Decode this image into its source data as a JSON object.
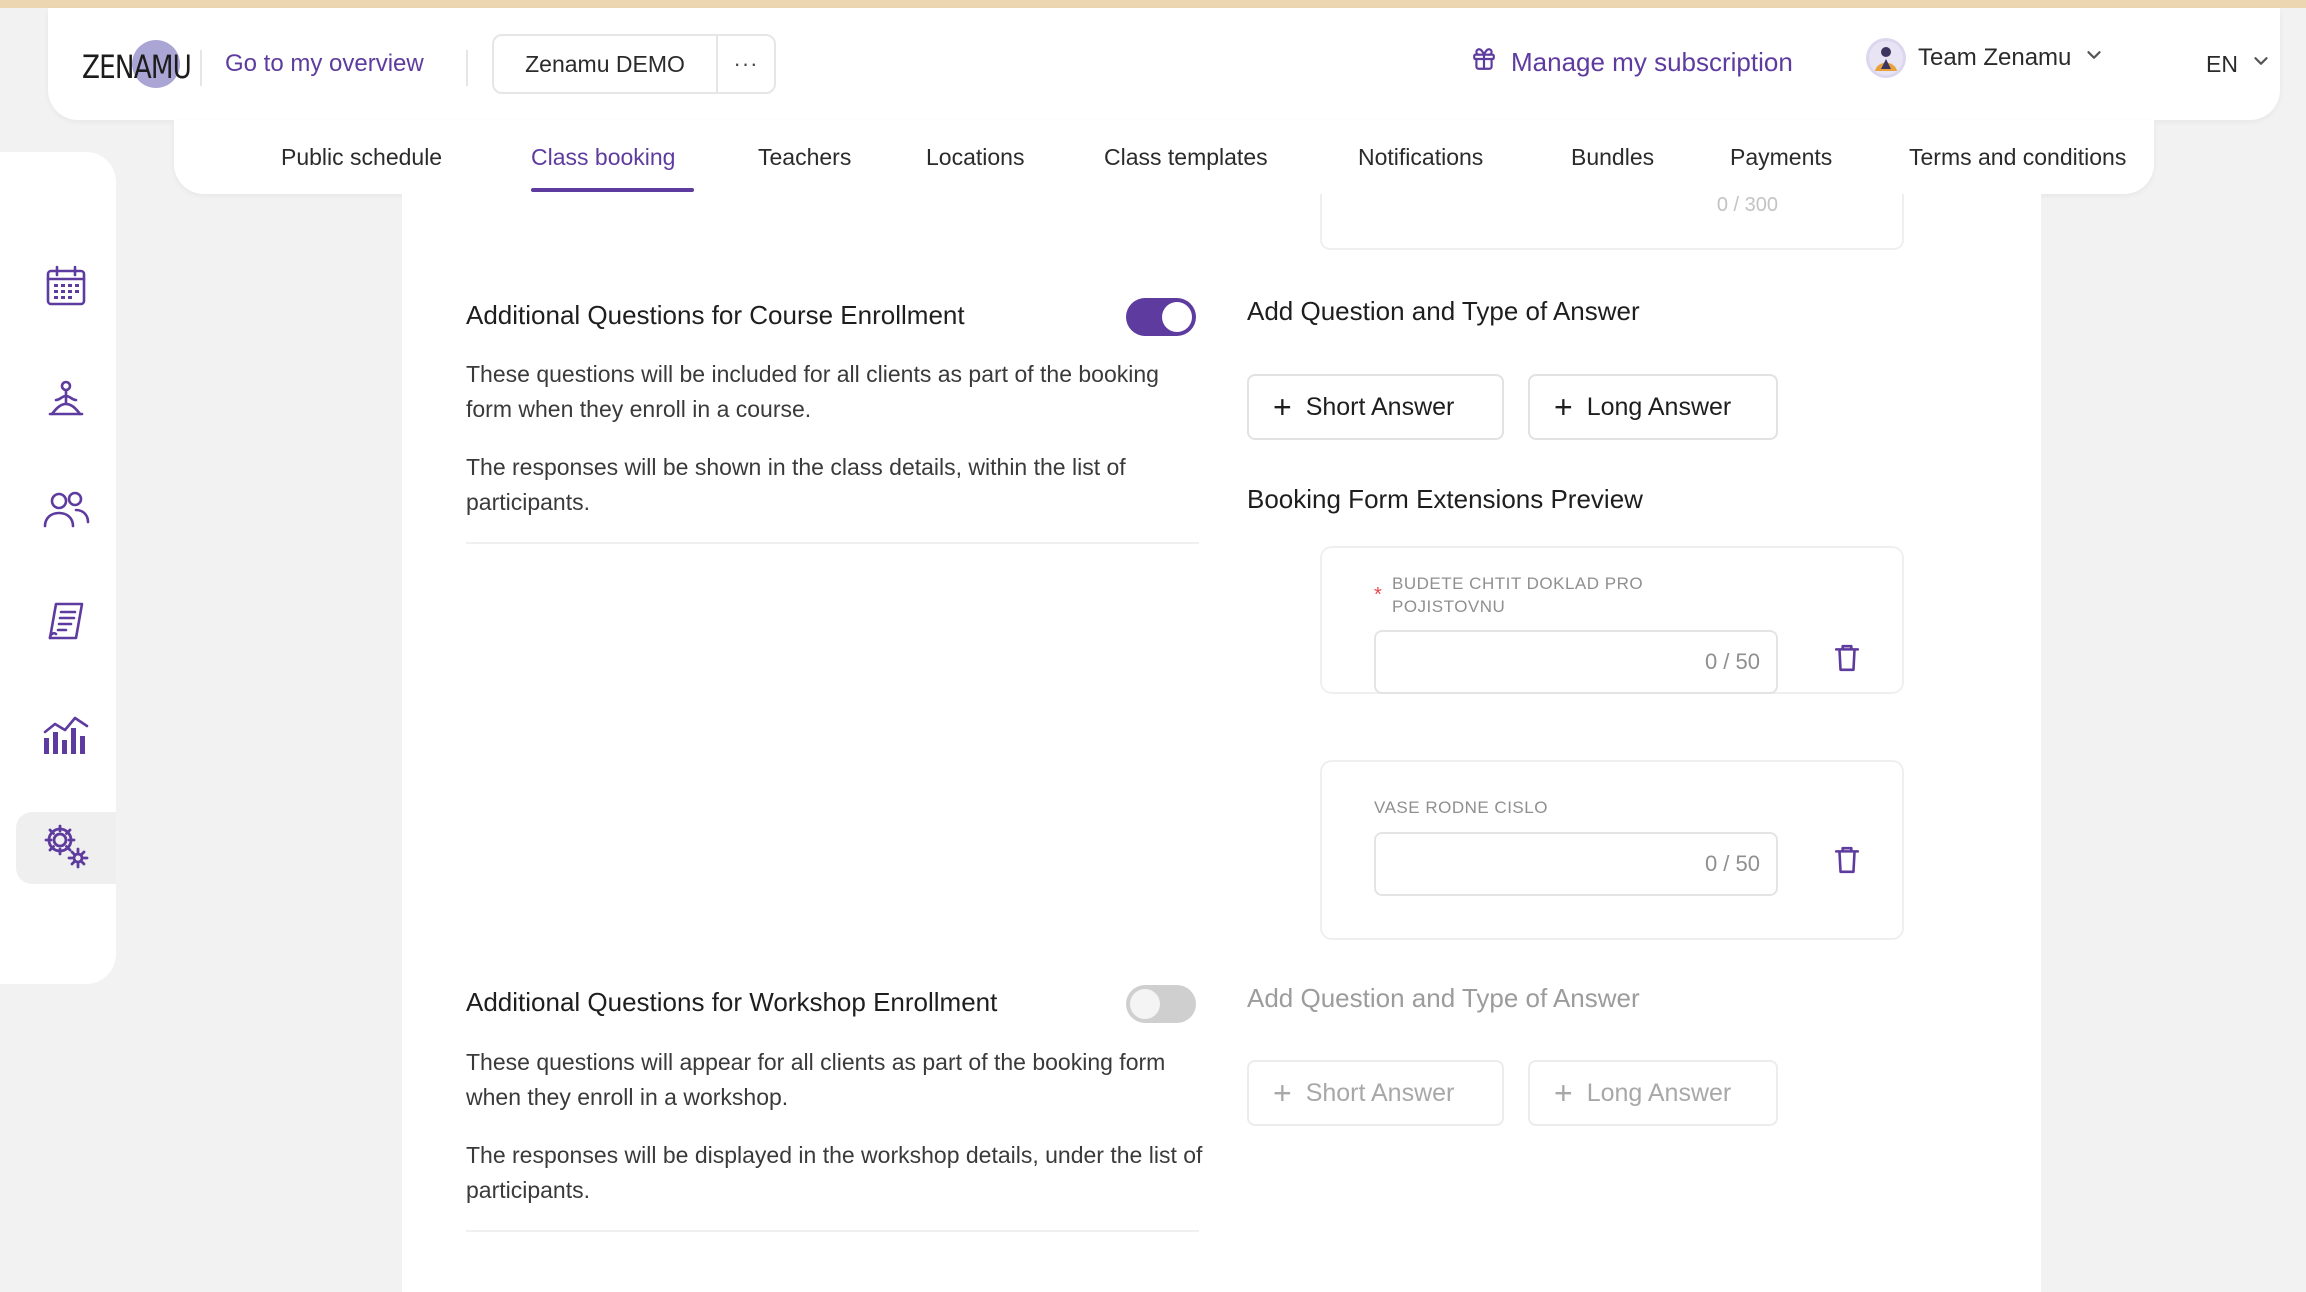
{
  "header": {
    "logo_text": "ZENAMU",
    "overview_link": "Go to my overview",
    "studio_name": "Zenamu DEMO",
    "studio_more": "···",
    "subscription_link": "Manage my subscription",
    "team_name": "Team Zenamu",
    "language": "EN"
  },
  "tabs": [
    {
      "label": "Public schedule"
    },
    {
      "label": "Class booking"
    },
    {
      "label": "Teachers"
    },
    {
      "label": "Locations"
    },
    {
      "label": "Class templates"
    },
    {
      "label": "Notifications"
    },
    {
      "label": "Bundles"
    },
    {
      "label": "Payments"
    },
    {
      "label": "Terms and conditions"
    }
  ],
  "sidebar": {
    "items": [
      "calendar-icon",
      "yoga-icon",
      "people-icon",
      "receipt-icon",
      "chart-icon",
      "settings-icon"
    ],
    "active": "settings-icon"
  },
  "previous_field": {
    "counter": "0 / 300"
  },
  "course": {
    "title": "Additional Questions for Course Enrollment",
    "enabled": true,
    "desc1": "These questions will be included for all clients as part of the booking form when they enroll in a course.",
    "desc2": "The responses will be shown in the class details, within the list of participants.",
    "add_title": "Add Question and Type of Answer",
    "short_answer": "Short Answer",
    "long_answer": "Long Answer",
    "preview_title": "Booking Form Extensions Preview",
    "questions": [
      {
        "label": "BUDETE CHTIT DOKLAD PRO POJISTOVNU",
        "required": true,
        "counter": "0 / 50"
      },
      {
        "label": "VASE RODNE CISLO",
        "required": false,
        "counter": "0 / 50"
      }
    ]
  },
  "workshop": {
    "title": "Additional Questions for Workshop Enrollment",
    "enabled": false,
    "desc1": "These questions will appear for all clients as part of the booking form when they enroll in a workshop.",
    "desc2": "The responses will be displayed in the workshop details, under the list of participants.",
    "add_title": "Add Question and Type of Answer",
    "short_answer": "Short Answer",
    "long_answer": "Long Answer"
  },
  "colors": {
    "accent": "#5e3b9e",
    "required": "#e5484d",
    "background": "#f2f2f2"
  }
}
